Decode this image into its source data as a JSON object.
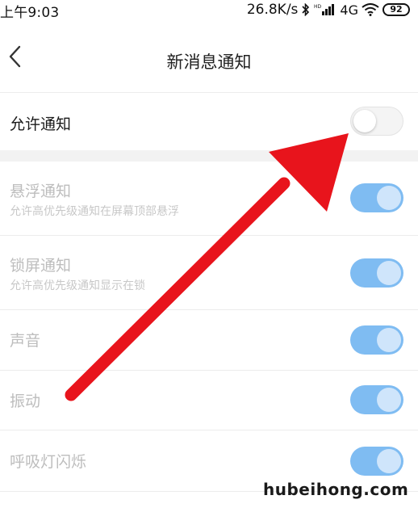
{
  "status_bar": {
    "time": "上午9:03",
    "network_speed": "26.8K/s",
    "network_type": "4G",
    "battery_level": "92"
  },
  "header": {
    "title": "新消息通知"
  },
  "allow_notification": {
    "label": "允许通知",
    "enabled": false
  },
  "settings": [
    {
      "title": "悬浮通知",
      "subtitle": "允许高优先级通知在屏幕顶部悬浮",
      "enabled": true
    },
    {
      "title": "锁屏通知",
      "subtitle": "允许高优先级通知显示在锁",
      "enabled": true
    },
    {
      "title": "声音",
      "enabled": true
    },
    {
      "title": "振动",
      "enabled": true
    },
    {
      "title": "呼吸灯闪烁",
      "enabled": true
    }
  ],
  "watermark": "hubeihong.com",
  "colors": {
    "toggle_on": "#7fbcf2",
    "arrow": "#e8141c"
  }
}
